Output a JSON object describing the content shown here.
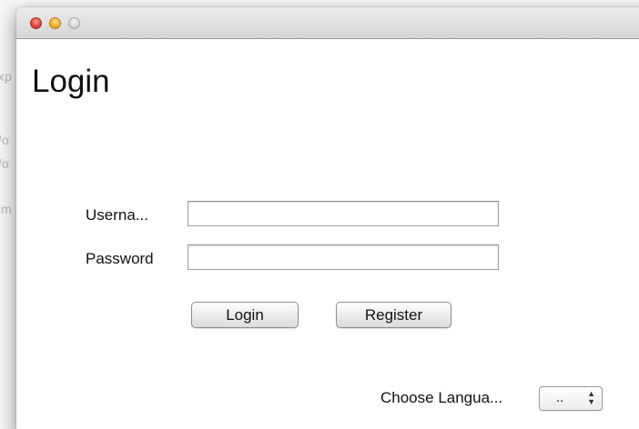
{
  "background_app": {
    "fragments": [
      "xp",
      "/o",
      "/o",
      "im"
    ]
  },
  "window": {
    "title_buttons": {
      "close": {
        "icon": "close-dot",
        "color": "#e2463d"
      },
      "minimize": {
        "icon": "minimize-dot",
        "color": "#f1b22c"
      },
      "zoom": {
        "icon": "zoom-dot",
        "color": "#d7d7d7"
      }
    }
  },
  "form": {
    "title": "Login",
    "username_label": "Userna...",
    "username_value": "",
    "password_label": "Password",
    "password_value": "",
    "login_button": "Login",
    "register_button": "Register"
  },
  "language": {
    "label": "Choose Langua...",
    "selected": "..",
    "arrows": "▴▾"
  }
}
